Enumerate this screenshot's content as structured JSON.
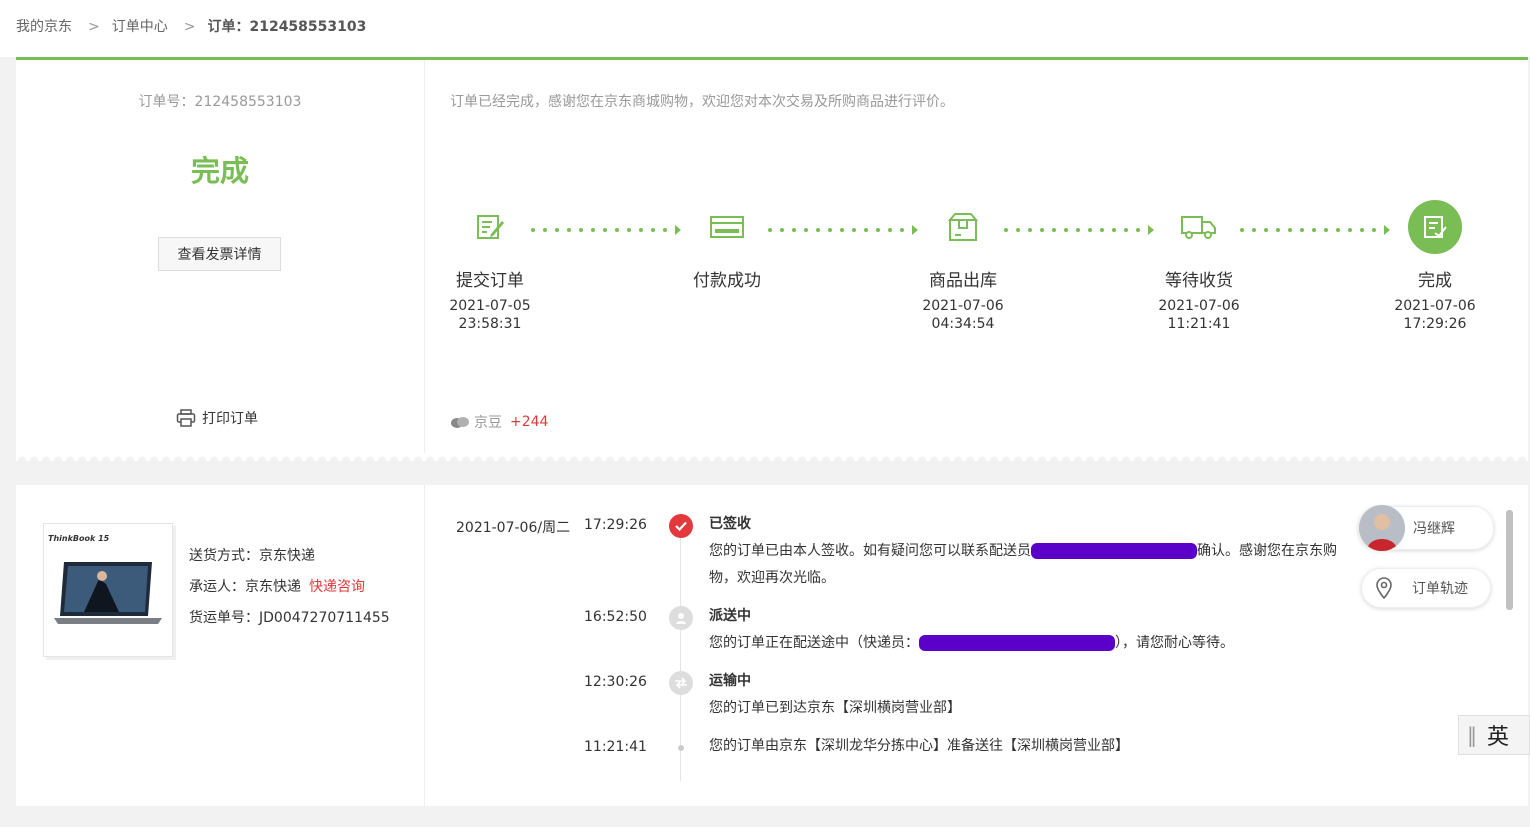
{
  "breadcrumb": {
    "items": [
      "我的京东",
      "订单中心",
      "订单：212458553103"
    ]
  },
  "order": {
    "number_label": "订单号：212458553103",
    "status": "完成",
    "invoice_button": "查看发票详情",
    "print_label": "打印订单",
    "notice": "订单已经完成，感谢您在京东商城购物，欢迎您对本次交易及所购商品进行评价。",
    "beans_label": "京豆",
    "beans_value": "+244"
  },
  "progress": {
    "steps": [
      {
        "label": "提交订单",
        "date": "2021-07-05",
        "time": "23:58:31",
        "icon": "form-edit-icon"
      },
      {
        "label": "付款成功",
        "date": "",
        "time": "",
        "icon": "card-icon"
      },
      {
        "label": "商品出库",
        "date": "2021-07-06",
        "time": "04:34:54",
        "icon": "box-icon"
      },
      {
        "label": "等待收货",
        "date": "2021-07-06",
        "time": "11:21:41",
        "icon": "truck-icon"
      },
      {
        "label": "完成",
        "date": "2021-07-06",
        "time": "17:29:26",
        "icon": "done-check-icon"
      }
    ]
  },
  "shipping": {
    "product_brand": "ThinkBook 15",
    "method": "送货方式：京东快递",
    "carrier": "承运人：京东快递",
    "carrier_link": "快递咨询",
    "tracking_no": "货运单号：JD0047270711455"
  },
  "tracking": {
    "events": [
      {
        "date": "2021-07-06/周二",
        "time": "17:29:26",
        "title": "已签收",
        "text_before": "您的订单已由本人签收。如有疑问您可以联系配送员",
        "text_after": "确认。感谢您在京东购物，欢迎再次光临。"
      },
      {
        "date": "",
        "time": "16:52:50",
        "title": "派送中",
        "text_before": "您的订单正在配送途中（快递员：",
        "text_after": "），请您耐心等待。"
      },
      {
        "date": "",
        "time": "12:30:26",
        "title": "运输中",
        "text_before": "您的订单已到达京东【深圳横岗营业部】",
        "text_after": ""
      },
      {
        "date": "",
        "time": "11:21:41",
        "title": "",
        "text_before": "您的订单由京东【深圳龙华分拣中心】准备送往【深圳横岗营业部】",
        "text_after": ""
      }
    ]
  },
  "sidebar": {
    "courier_name": "冯继辉",
    "track_label": "订单轨迹"
  },
  "ime": {
    "mode": "英"
  },
  "colors": {
    "accent": "#7abd54",
    "red": "#e4393c",
    "redaction": "#5b00c8"
  }
}
